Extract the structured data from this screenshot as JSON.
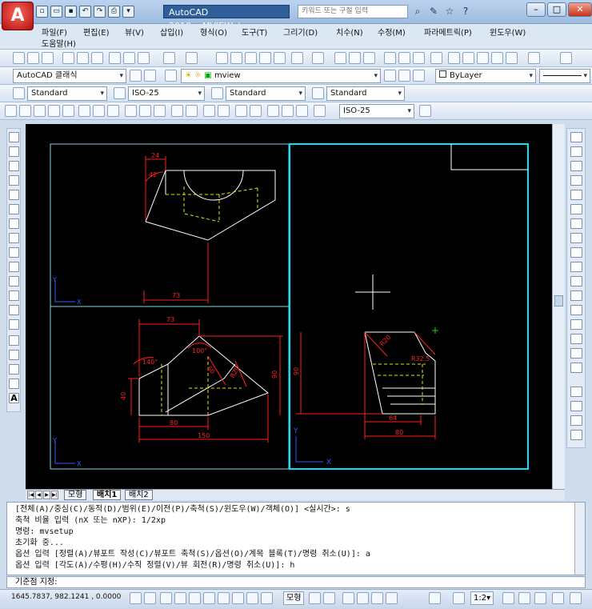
{
  "app": {
    "title": "AutoCAD 2010",
    "document": "MVIEW.dwg",
    "logo": "A"
  },
  "search": {
    "placeholder": "키워드 또는 구절 입력"
  },
  "menu": [
    "파일(F)",
    "편집(E)",
    "뷰(V)",
    "삽입(I)",
    "형식(O)",
    "도구(T)",
    "그리기(D)",
    "치수(N)",
    "수정(M)",
    "파라메트릭(P)",
    "윈도우(W)",
    "도움말(H)"
  ],
  "toolbar2": {
    "workspace": "AutoCAD 클래식",
    "layer": "mview",
    "color": "ByLayer"
  },
  "toolbar3": {
    "text_style": "Standard",
    "dim_style": "ISO-25",
    "table_style": "Standard",
    "multileader_style": "Standard"
  },
  "toolbar4": {
    "dim_style2": "ISO-25"
  },
  "tabs": [
    "모형",
    "배치1",
    "배치2"
  ],
  "active_tab": "배치1",
  "command_history": [
    "[전체(A)/중심(C)/동적(D)/범위(E)/이전(P)/축척(S)/윈도우(W)/객체(O)] <실시간>: s",
    "축척 비율 입력 (nX 또는 nXP): 1/2xp",
    "명령: mvsetup",
    "초기화 중...",
    "옵션 입력 [정렬(A)/뷰포트 작성(C)/뷰포트 축척(S)/옵션(O)/계목 블록(T)/명령 취소(U)]: a",
    "옵션 입력 [각도(A)/수평(H)/수직 정렬(V)/뷰 회전(R)/명령 취소(U)]: h"
  ],
  "prompt": "기준점 지정:",
  "status": {
    "coords": "1645.7837, 982.1241 , 0.0000",
    "model": "모형",
    "scale": "1:2▾"
  },
  "drawing_labels": {
    "d24": "24",
    "d42": "42",
    "d73a": "73",
    "d73b": "73",
    "d100": "100°",
    "d140": "140°",
    "d60": "60",
    "d40": "40",
    "d80a": "80",
    "d150": "150",
    "d90a": "90",
    "d90b": "90",
    "dr20": "R20",
    "dr325": "R32.5",
    "d64": "64",
    "d80b": "80",
    "x": "X",
    "y": "Y"
  },
  "colors": {
    "viewport_active": "#00e5ff",
    "viewport": "#7fd4dc",
    "dim": "#ff2020",
    "hidden": "#e6e600",
    "geometry": "#ffffff",
    "ucs": "#2f5bff"
  }
}
